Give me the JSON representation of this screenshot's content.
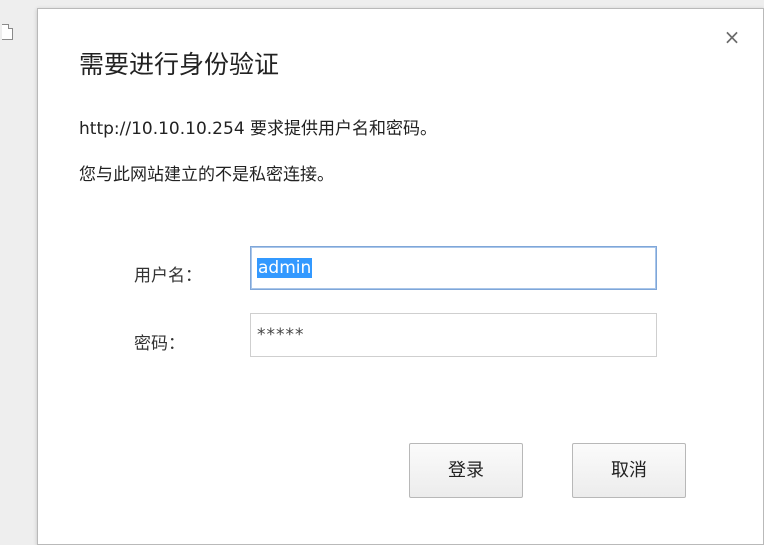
{
  "dialog": {
    "title": "需要进行身份验证",
    "close_glyph": "×",
    "message_line1": "http://10.10.10.254 要求提供用户名和密码。",
    "message_line2": "您与此网站建立的不是私密连接。",
    "username": {
      "label": "用户名：",
      "value": "admin"
    },
    "password": {
      "label": "密码：",
      "value": "*****"
    },
    "buttons": {
      "login": "登录",
      "cancel": "取消"
    }
  },
  "icons": {
    "page": "page-icon",
    "close": "close-icon"
  },
  "colors": {
    "selection": "#3399ff",
    "focus_border": "#7fa6d8"
  }
}
